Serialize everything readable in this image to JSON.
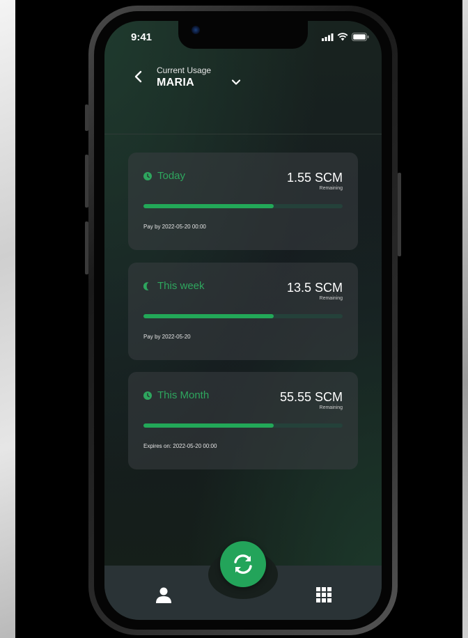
{
  "status_bar": {
    "time": "9:41"
  },
  "header": {
    "subtitle": "Current Usage",
    "title": "MARIA"
  },
  "cards": [
    {
      "label": "Today",
      "icon": "clock-icon",
      "value": "1.55 SCM",
      "value_caption": "Remaining",
      "progress": 0.655,
      "note": "Pay by 2022-05-20 00:00"
    },
    {
      "label": "This week",
      "icon": "moon-icon",
      "value": "13.5 SCM",
      "value_caption": "Remaining",
      "progress": 0.655,
      "note": "Pay by 2022-05-20"
    },
    {
      "label": "This Month",
      "icon": "clock-icon",
      "value": "55.55 SCM",
      "value_caption": "Remaining",
      "progress": 0.655,
      "note": "Expires on: 2022-05-20 00:00"
    }
  ],
  "tab_bar": {
    "left_icon": "user-icon",
    "center_icon": "refresh-icon",
    "right_icon": "grid-icon"
  },
  "colors": {
    "accent": "#22a858",
    "label_green": "#2ea65e",
    "card_bg": "#3a3e42",
    "track": "#24413a"
  }
}
